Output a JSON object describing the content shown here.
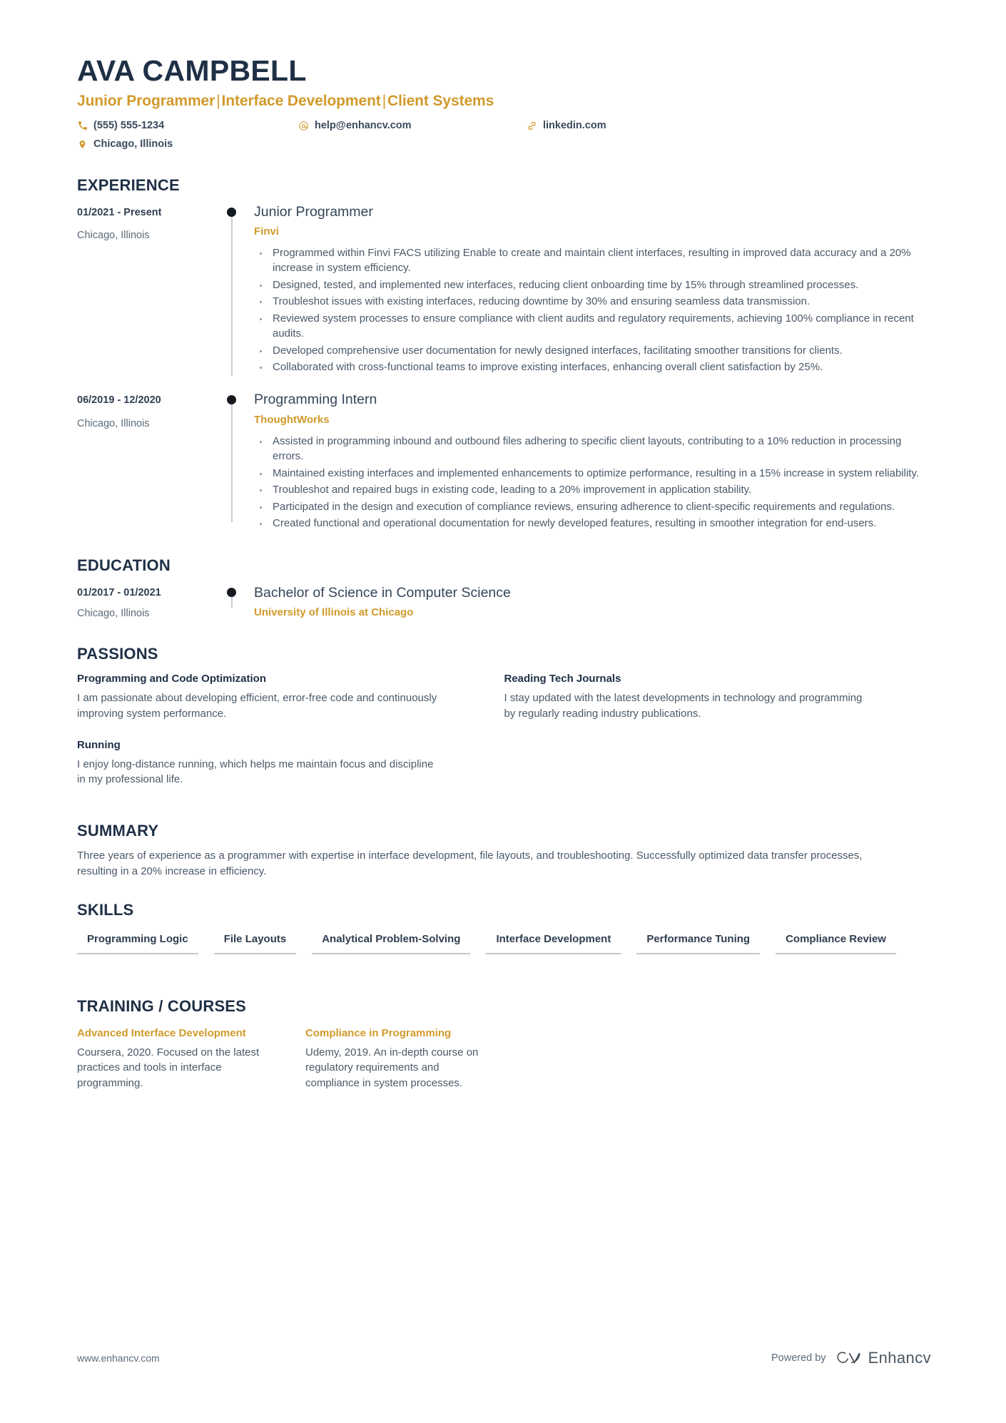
{
  "theme": {
    "accent": "#d19a2a",
    "heading": "#1f3046",
    "body_text": "#4b5968",
    "rail": "#c7ccd2",
    "dot": "#141a20"
  },
  "header": {
    "name": "AVA CAMPBELL",
    "headline_parts": [
      "Junior Programmer",
      "Interface Development",
      "Client Systems"
    ],
    "headline_separator": "|",
    "contacts": [
      {
        "icon": "phone-icon",
        "value": "(555) 555-1234"
      },
      {
        "icon": "email-icon",
        "value": "help@enhancv.com"
      },
      {
        "icon": "link-icon",
        "value": "linkedin.com"
      },
      {
        "icon": "location-icon",
        "value": "Chicago, Illinois"
      }
    ]
  },
  "sections": {
    "experience": {
      "title": "EXPERIENCE",
      "entries": [
        {
          "date": "01/2021 - Present",
          "location": "Chicago, Illinois",
          "role": "Junior Programmer",
          "org": "Finvi",
          "bullets": [
            "Programmed within Finvi FACS utilizing Enable to create and maintain client interfaces, resulting in improved data accuracy and a 20% increase in system efficiency.",
            "Designed, tested, and implemented new interfaces, reducing client onboarding time by 15% through streamlined processes.",
            "Troubleshot issues with existing interfaces, reducing downtime by 30% and ensuring seamless data transmission.",
            "Reviewed system processes to ensure compliance with client audits and regulatory requirements, achieving 100% compliance in recent audits.",
            "Developed comprehensive user documentation for newly designed interfaces, facilitating smoother transitions for clients.",
            "Collaborated with cross-functional teams to improve existing interfaces, enhancing overall client satisfaction by 25%."
          ]
        },
        {
          "date": "06/2019 - 12/2020",
          "location": "Chicago, Illinois",
          "role": "Programming Intern",
          "org": "ThoughtWorks",
          "bullets": [
            "Assisted in programming inbound and outbound files adhering to specific client layouts, contributing to a 10% reduction in processing errors.",
            "Maintained existing interfaces and implemented enhancements to optimize performance, resulting in a 15% increase in system reliability.",
            "Troubleshot and repaired bugs in existing code, leading to a 20% improvement in application stability.",
            "Participated in the design and execution of compliance reviews, ensuring adherence to client-specific requirements and regulations.",
            "Created functional and operational documentation for newly developed features, resulting in smoother integration for end-users."
          ]
        }
      ]
    },
    "education": {
      "title": "EDUCATION",
      "entries": [
        {
          "date": "01/2017 - 01/2021",
          "location": "Chicago, Illinois",
          "degree": "Bachelor of Science in Computer Science",
          "school": "University of Illinois at Chicago"
        }
      ]
    },
    "passions": {
      "title": "PASSIONS",
      "items": [
        {
          "title": "Programming and Code Optimization",
          "text": "I am passionate about developing efficient, error-free code and continuously improving system performance."
        },
        {
          "title": "Reading Tech Journals",
          "text": "I stay updated with the latest developments in technology and programming by regularly reading industry publications."
        },
        {
          "title": "Running",
          "text": "I enjoy long-distance running, which helps me maintain focus and discipline in my professional life."
        }
      ]
    },
    "summary": {
      "title": "SUMMARY",
      "text": "Three years of experience as a programmer with expertise in interface development, file layouts, and troubleshooting. Successfully optimized data transfer processes, resulting in a 20% increase in efficiency."
    },
    "skills": {
      "title": "SKILLS",
      "items": [
        "Programming Logic",
        "File Layouts",
        "Analytical Problem-Solving",
        "Interface Development",
        "Performance Tuning",
        "Compliance Review"
      ]
    },
    "training": {
      "title": "TRAINING / COURSES",
      "items": [
        {
          "title": "Advanced Interface Development",
          "text": "Coursera, 2020. Focused on the latest practices and tools in interface programming."
        },
        {
          "title": "Compliance in Programming",
          "text": "Udemy, 2019. An in-depth course on regulatory requirements and compliance in system processes."
        }
      ]
    }
  },
  "footer": {
    "url": "www.enhancv.com",
    "powered_by": "Powered by",
    "brand": "Enhancv"
  }
}
